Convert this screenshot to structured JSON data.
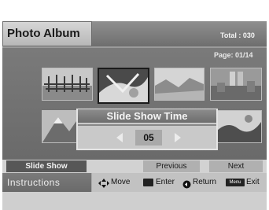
{
  "header": {
    "title": "Photo Album",
    "total": "Total : 030"
  },
  "main": {
    "page": "Page: 01/14"
  },
  "dialog": {
    "title": "Slide Show Time",
    "value": "05"
  },
  "buttons": {
    "slideshow": "Slide Show",
    "previous": "Previous",
    "next": "Next"
  },
  "instructions": {
    "label": "Instructions",
    "move": "Move",
    "enter": "Enter",
    "return": "Return",
    "menu_key": "Menu",
    "exit": "Exit"
  },
  "icons": [
    "updown-leftright-arrows-icon",
    "enter-key-icon",
    "return-circle-icon",
    "menu-key-icon",
    "left-arrow-icon",
    "right-arrow-icon"
  ],
  "colors": {
    "header_bg": "#7f7f7f",
    "panel_bg": "#747474",
    "selected_button": "#575757"
  }
}
